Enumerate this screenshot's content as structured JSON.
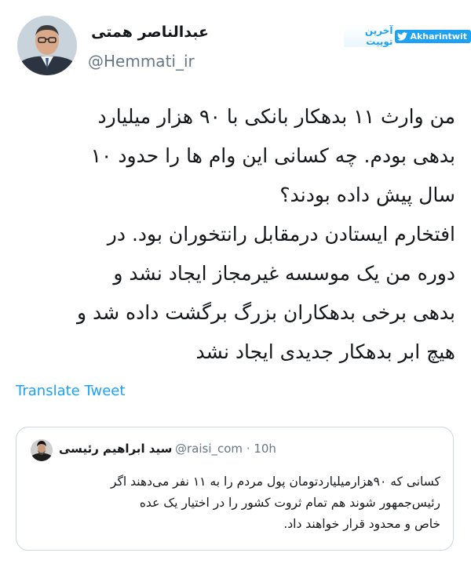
{
  "author": {
    "display_name": "عبدالناصر همتی",
    "handle": "@Hemmati_ir"
  },
  "brand": {
    "persian_label": "آخرین توییت",
    "label": "Akharintwit",
    "icon": "twitter-bird-icon"
  },
  "tweet": {
    "lines": [
      "من وارث ۱۱ بدهکار بانکی با ۹۰ هزار میلیارد",
      "بدهی بودم. چه کسانی این وام ها را حدود ۱۰",
      "سال پیش داده بودند؟",
      "افتخارم ایستادن درمقابل رانتخوران بود. در",
      "دوره من یک موسسه غیرمجاز ایجاد نشد و",
      "بدهی برخی بدهکاران بزرگ برگشت داده شد و",
      "هیچ ابر بدهکار جدیدی ایجاد نشد"
    ],
    "translate_label": "Translate Tweet"
  },
  "quoted_tweet": {
    "display_name": "سید ابراهیم رئیسی",
    "handle_time": "@raisi_com · 10h",
    "lines": [
      "کسانی که ۹۰هزارمیلیاردتومان پول مردم را به ۱۱ نفر می‌دهند اگر",
      "رئیس‌جمهور شوند هم تمام ثروت کشور را در اختیار یک عده",
      "خاص و محدود قرار خواهند داد."
    ]
  },
  "colors": {
    "accent": "#1da1f2",
    "text": "#14171a",
    "secondary_text": "#657786",
    "border": "#ccd6dd"
  }
}
